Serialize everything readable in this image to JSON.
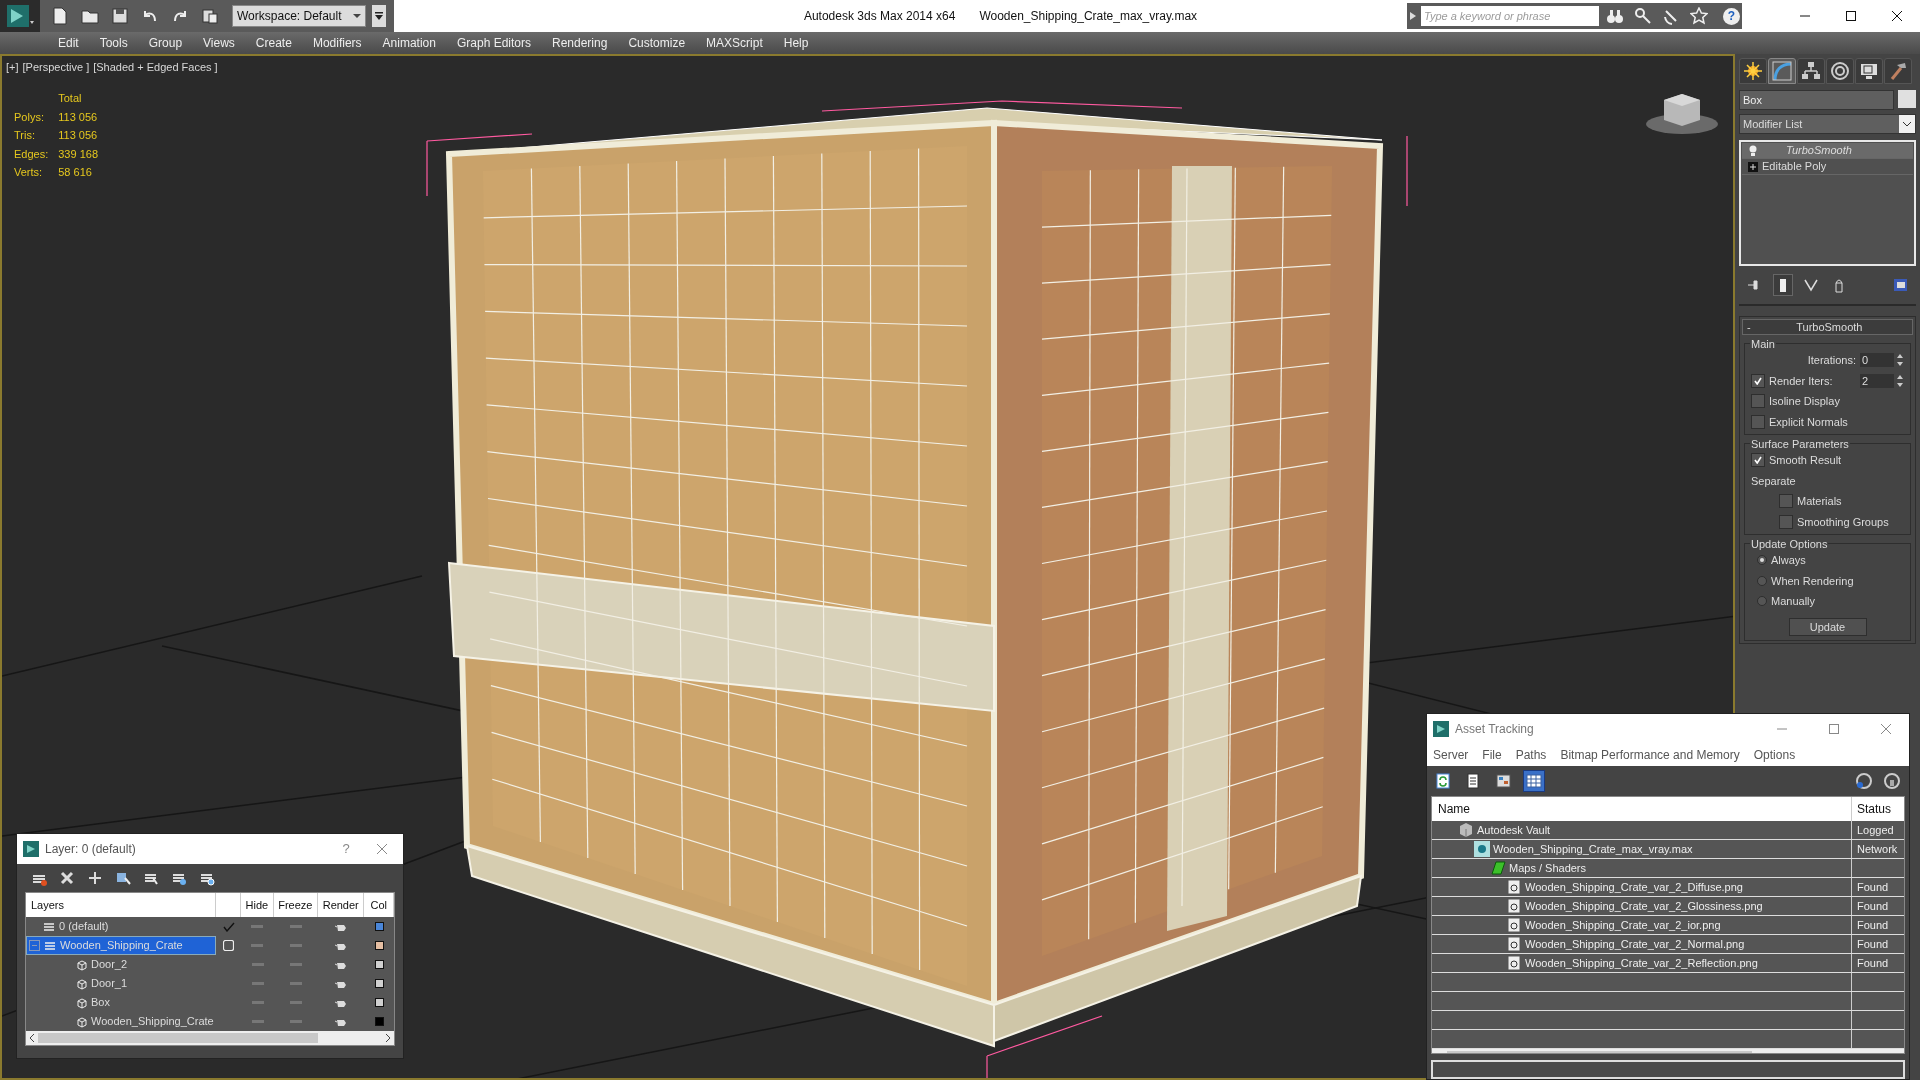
{
  "title_bar": {
    "workspace": "Workspace: Default",
    "app_title": "Autodesk 3ds Max  2014 x64",
    "file_name": "Wooden_Shipping_Crate_max_vray.max",
    "search": {
      "placeholder": "Type a keyword or phrase"
    },
    "help": "?"
  },
  "menu": [
    "Edit",
    "Tools",
    "Group",
    "Views",
    "Create",
    "Modifiers",
    "Animation",
    "Graph Editors",
    "Rendering",
    "Customize",
    "MAXScript",
    "Help"
  ],
  "viewport": {
    "labels": [
      "[+]",
      "[Perspective ]",
      "[Shaded + Edged Faces ]"
    ],
    "stats_header": "Total",
    "stats": [
      {
        "label": "Polys:",
        "value": "113 056"
      },
      {
        "label": "Tris:",
        "value": "113 056"
      },
      {
        "label": "Edges:",
        "value": "339 168"
      },
      {
        "label": "Verts:",
        "value": "58 616"
      }
    ]
  },
  "command_panel": {
    "tabs": [
      {
        "selected": false
      },
      {
        "selected": true
      },
      {
        "selected": false
      },
      {
        "selected": false
      },
      {
        "selected": false
      },
      {
        "selected": false
      }
    ],
    "object_name": "Box",
    "modifier_list": "Modifier List",
    "stack": [
      {
        "kind": "modifier",
        "label": "TurboSmooth",
        "selected": true
      },
      {
        "kind": "base",
        "label": "Editable Poly",
        "selected": false
      }
    ],
    "rollout": {
      "collapse": "-",
      "title": "TurboSmooth",
      "groups": [
        {
          "title": "Main",
          "items": [
            {
              "kind": "spinner",
              "label": "Iterations:",
              "value": "0"
            },
            {
              "kind": "checkbox_spinner",
              "label": "Render Iters:",
              "value": "2",
              "checked": true
            },
            {
              "kind": "checkbox",
              "label": "Isoline Display",
              "checked": false
            },
            {
              "kind": "checkbox",
              "label": "Explicit Normals",
              "checked": false
            }
          ]
        },
        {
          "title": "Surface Parameters",
          "items": [
            {
              "kind": "checkbox",
              "label": "Smooth Result",
              "checked": true
            },
            {
              "kind": "label",
              "label": "Separate"
            },
            {
              "kind": "sub_checkbox",
              "label": "Materials",
              "checked": false
            },
            {
              "kind": "sub_checkbox",
              "label": "Smoothing Groups",
              "checked": false
            }
          ]
        },
        {
          "title": "Update Options",
          "items": [
            {
              "kind": "radio",
              "label": "Always",
              "selected": true
            },
            {
              "kind": "radio",
              "label": "When Rendering",
              "selected": false
            },
            {
              "kind": "radio",
              "label": "Manually",
              "selected": false
            },
            {
              "kind": "button",
              "label": "Update"
            }
          ]
        }
      ]
    }
  },
  "layer_dialog": {
    "title": "Layer: 0 (default)",
    "help": "?",
    "columns": [
      "Layers",
      "Hide",
      "Freeze",
      "Render",
      "Col"
    ],
    "rows": [
      {
        "kind": "layer",
        "label": "0 (default)",
        "current": true,
        "selected": false,
        "color": "#4a86d8",
        "children": []
      },
      {
        "kind": "layer",
        "label": "Wooden_Shipping_Crate",
        "current": false,
        "selected": true,
        "color": "#e6bfa3",
        "children": [
          {
            "kind": "object",
            "label": "Door_2",
            "selected": false,
            "color": "#d0d0d0"
          },
          {
            "kind": "object",
            "label": "Door_1",
            "selected": false,
            "color": "#d0d0d0"
          },
          {
            "kind": "object",
            "label": "Box",
            "selected": false,
            "color": "#d0d0d0"
          },
          {
            "kind": "object",
            "label": "Wooden_Shipping_Crate",
            "selected": false,
            "color": "#000000"
          }
        ]
      }
    ]
  },
  "asset_tracking": {
    "title": "Asset Tracking",
    "menu": [
      "Server",
      "File",
      "Paths",
      "Bitmap Performance and Memory",
      "Options"
    ],
    "toolbar": [
      {
        "selected": false
      },
      {
        "selected": false
      },
      {
        "selected": false
      },
      {
        "selected": true
      }
    ],
    "columns": [
      "Name",
      "Status"
    ],
    "rows": [
      {
        "kind": "vault",
        "name": "Autodesk Vault",
        "status": "Logged",
        "children": [
          {
            "kind": "max_file",
            "name": "Wooden_Shipping_Crate_max_vray.max",
            "status": "Network",
            "children": [
              {
                "kind": "folder",
                "name": "Maps / Shaders",
                "children": [
                  {
                    "kind": "bitmap",
                    "name": "Wooden_Shipping_Crate_var_2_Diffuse.png",
                    "status": "Found"
                  },
                  {
                    "kind": "bitmap",
                    "name": "Wooden_Shipping_Crate_var_2_Glossiness.png",
                    "status": "Found"
                  },
                  {
                    "kind": "bitmap",
                    "name": "Wooden_Shipping_Crate_var_2_ior.png",
                    "status": "Found"
                  },
                  {
                    "kind": "bitmap",
                    "name": "Wooden_Shipping_Crate_var_2_Normal.png",
                    "status": "Found"
                  },
                  {
                    "kind": "bitmap",
                    "name": "Wooden_Shipping_Crate_var_2_Reflection.png",
                    "status": "Found"
                  }
                ]
              }
            ]
          }
        ]
      }
    ]
  }
}
